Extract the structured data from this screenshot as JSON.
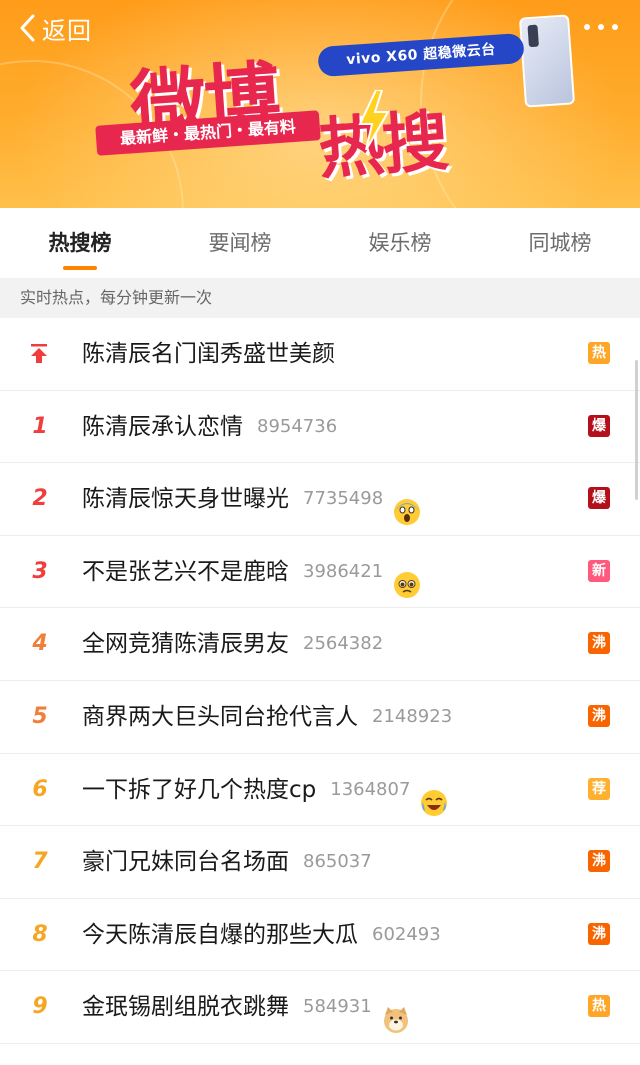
{
  "header": {
    "back_label": "返回",
    "title_main": "微博",
    "title_sub": "热搜",
    "slogan": "最新鲜・最热门・最有料",
    "sponsor": "vivo X60 超稳微云台"
  },
  "tabs": [
    {
      "label": "热搜榜",
      "active": true
    },
    {
      "label": "要闻榜",
      "active": false
    },
    {
      "label": "娱乐榜",
      "active": false
    },
    {
      "label": "同城榜",
      "active": false
    }
  ],
  "subhead": "实时热点，每分钟更新一次",
  "items": [
    {
      "rank": "",
      "pinned": true,
      "topic": "陈清辰名门闺秀盛世美颜",
      "count": "",
      "emoji": "",
      "badge": "热",
      "badge_color": "#ffa628"
    },
    {
      "rank": "1",
      "topic": "陈清辰承认恋情",
      "count": "8954736",
      "emoji": "",
      "badge": "爆",
      "badge_color": "#b4101b"
    },
    {
      "rank": "2",
      "topic": "陈清辰惊天身世曝光",
      "count": "7735498",
      "emoji": "scream-face-icon",
      "badge": "爆",
      "badge_color": "#b4101b"
    },
    {
      "rank": "3",
      "topic": "不是张艺兴不是鹿晗",
      "count": "3986421",
      "emoji": "pleading-face-icon",
      "badge": "新",
      "badge_color": "#ff5a7d"
    },
    {
      "rank": "4",
      "topic": "全网竞猜陈清辰男友",
      "count": "2564382",
      "emoji": "",
      "badge": "沸",
      "badge_color": "#f86400"
    },
    {
      "rank": "5",
      "topic": "商界两大巨头同台抢代言人",
      "count": "2148923",
      "emoji": "",
      "badge": "沸",
      "badge_color": "#f86400"
    },
    {
      "rank": "6",
      "topic": "一下拆了好几个热度cp",
      "count": "1364807",
      "emoji": "crying-laugh-icon",
      "badge": "荐",
      "badge_color": "#ffb02e"
    },
    {
      "rank": "7",
      "topic": "豪门兄妹同台名场面",
      "count": "865037",
      "emoji": "",
      "badge": "沸",
      "badge_color": "#f86400"
    },
    {
      "rank": "8",
      "topic": "今天陈清辰自爆的那些大瓜",
      "count": "602493",
      "emoji": "",
      "badge": "沸",
      "badge_color": "#f86400"
    },
    {
      "rank": "9",
      "topic": "金珉锡剧组脱衣跳舞",
      "count": "584931",
      "emoji": "doge-icon",
      "badge": "热",
      "badge_color": "#ffa628"
    }
  ]
}
